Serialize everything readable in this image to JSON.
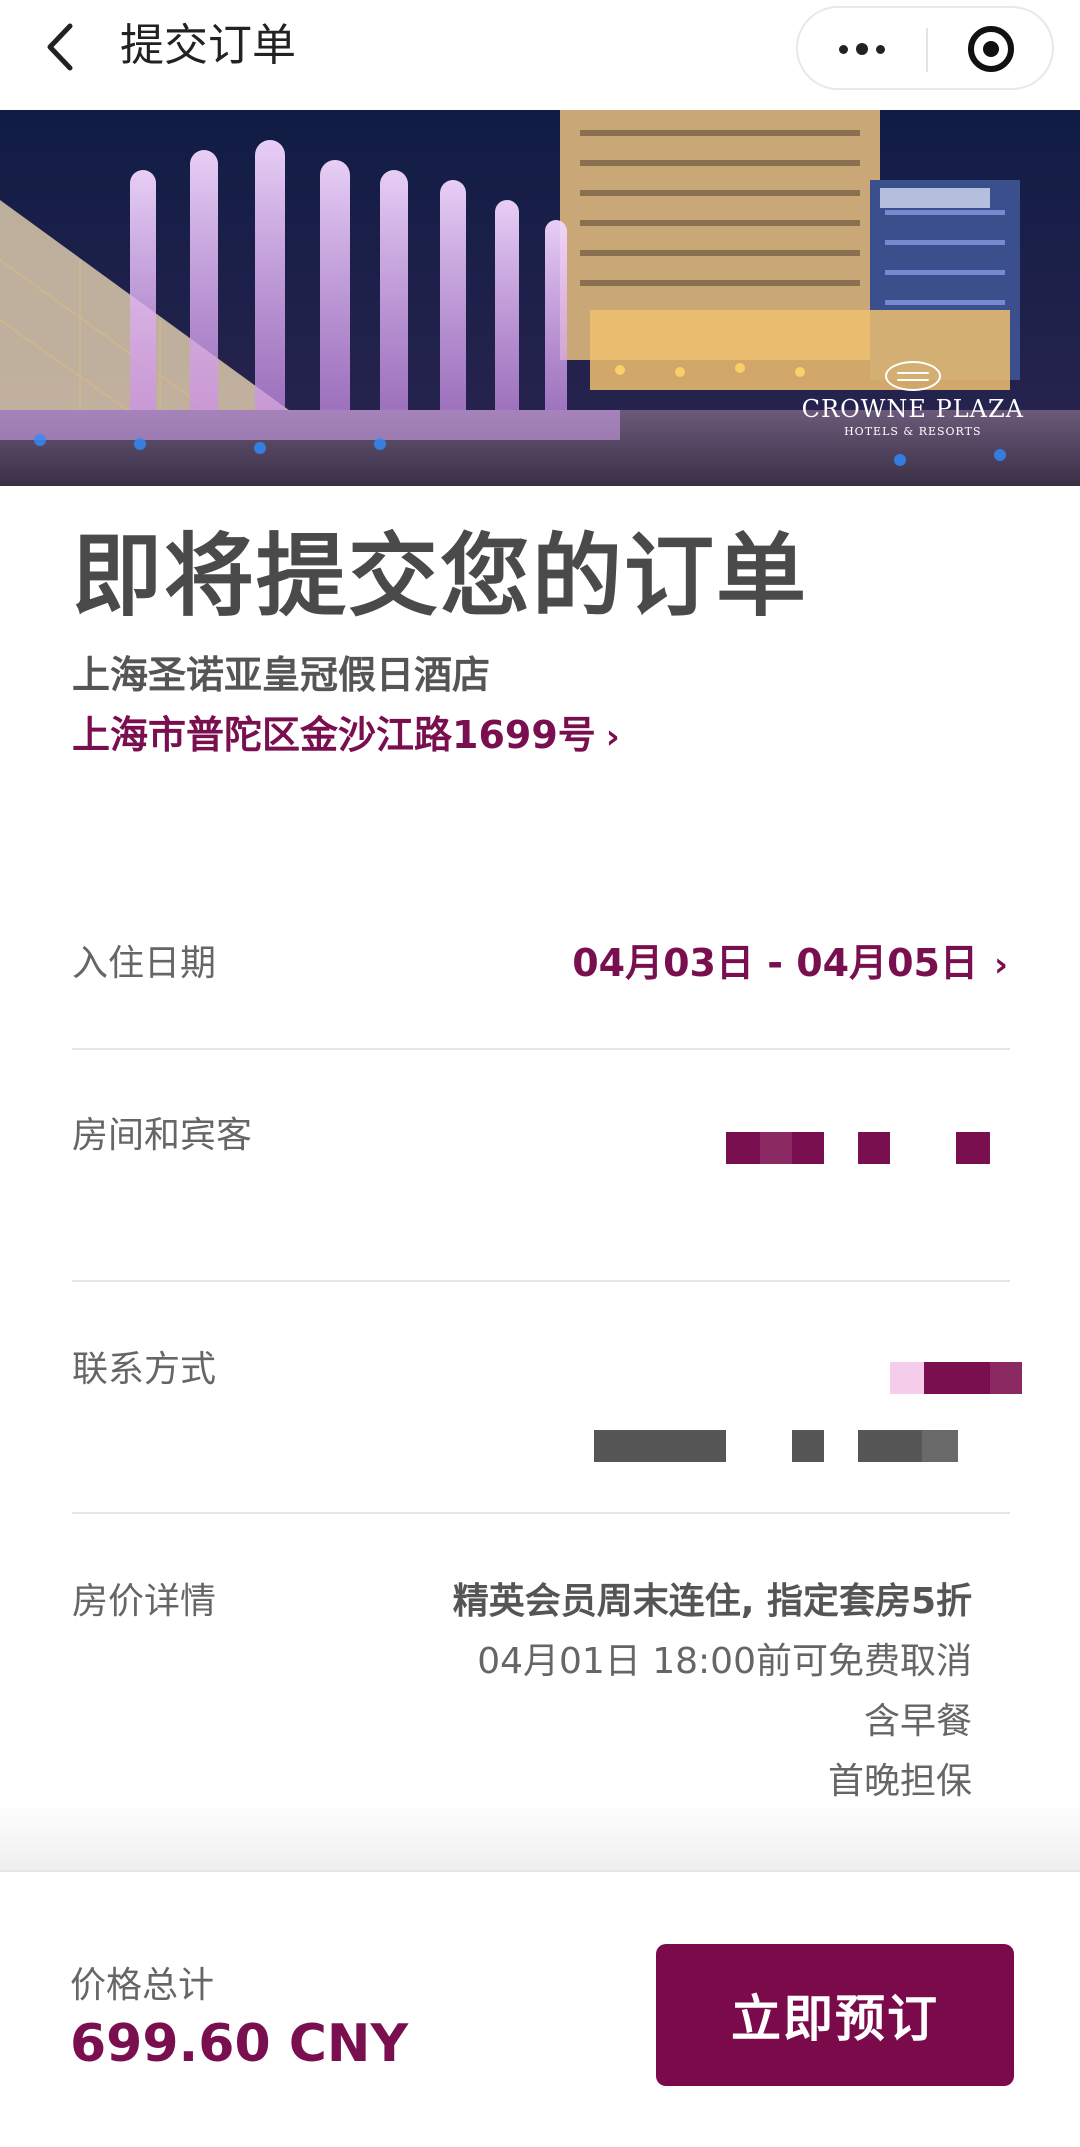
{
  "navbar": {
    "title": "提交订单",
    "back_icon": "chevron-left-icon",
    "more_icon": "more-dots-icon",
    "close_icon": "record-circle-icon"
  },
  "hero": {
    "image": "hotel exterior at night with illuminated pink fountains",
    "brand_name": "CROWNE PLAZA",
    "brand_sub": "HOTELS & RESORTS"
  },
  "header": {
    "title": "即将提交您的订单",
    "hotel_name": "上海圣诺亚皇冠假日酒店",
    "address": "上海市普陀区金沙江路1699号",
    "address_icon": "chevron-right-icon"
  },
  "rows": {
    "checkin": {
      "label": "入住日期",
      "value": "04月03日 - 04月05日",
      "icon": "chevron-right-icon"
    },
    "rooms_guests": {
      "label": "房间和宾客",
      "value_redacted": true
    },
    "contact": {
      "label": "联系方式",
      "value_redacted": true
    },
    "price_details": {
      "label": "房价详情",
      "offer": "精英会员周末连住, 指定套房5折",
      "cancellation": "04月01日 18:00前可免费取消",
      "breakfast": "含早餐",
      "guarantee": "首晚担保"
    }
  },
  "bottom_bar": {
    "total_label": "价格总计",
    "total_value": "699.60 CNY",
    "book_button": "立即预订"
  },
  "colors": {
    "accent": "#7a0f4f",
    "button": "#7a0a4a",
    "text_muted": "#666666"
  }
}
